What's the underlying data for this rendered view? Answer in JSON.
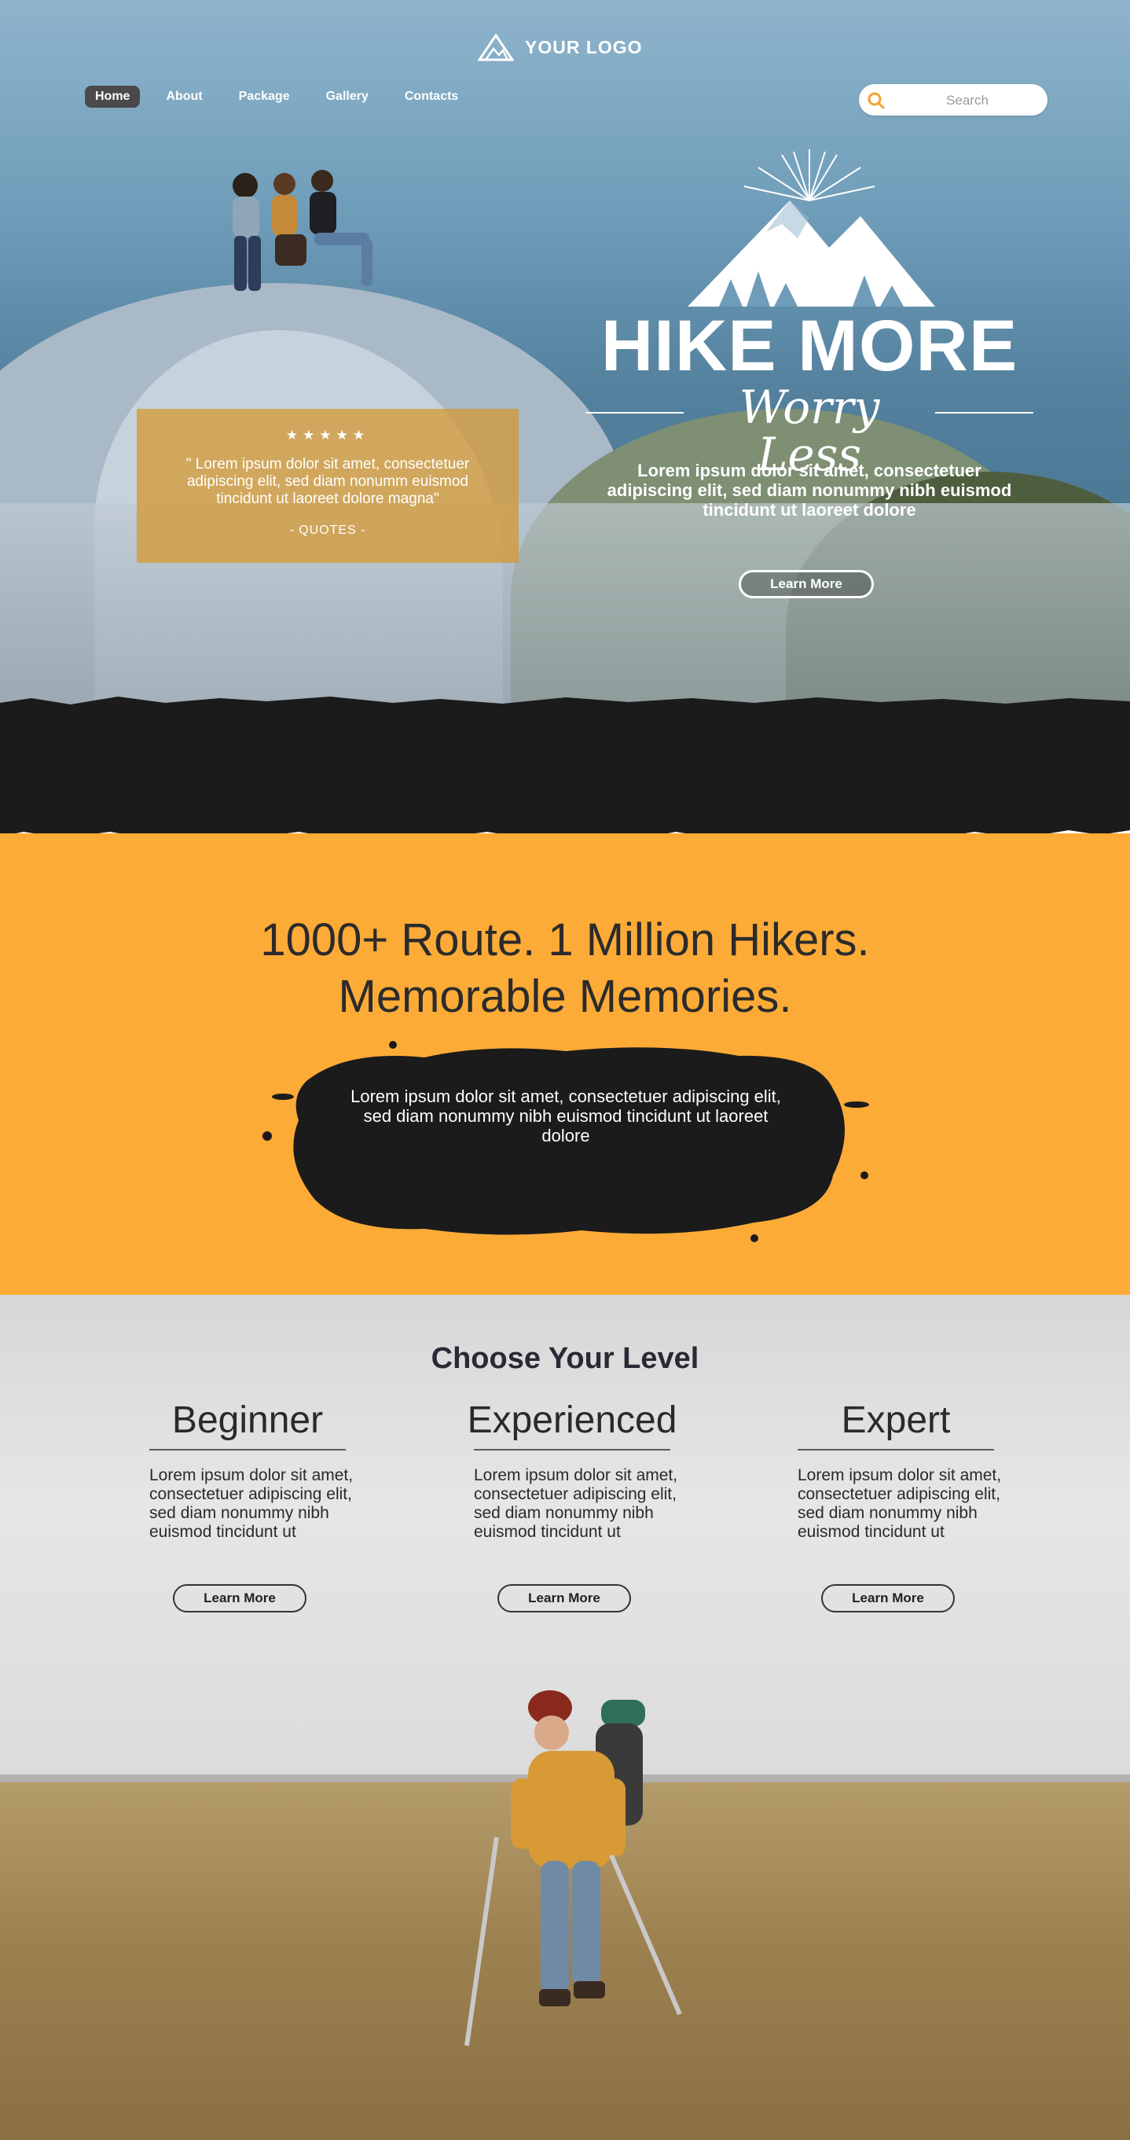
{
  "header": {
    "logo_text": "YOUR LOGO",
    "nav": [
      {
        "label": "Home",
        "active": true
      },
      {
        "label": "About",
        "active": false
      },
      {
        "label": "Package",
        "active": false
      },
      {
        "label": "Gallery",
        "active": false
      },
      {
        "label": "Contacts",
        "active": false
      }
    ],
    "search": {
      "placeholder": "Search",
      "value": ""
    }
  },
  "hero": {
    "quote": {
      "stars": "★★★★★",
      "text": "\" Lorem ipsum dolor sit amet, consectetuer adipiscing elit, sed diam nonumm euismod tincidunt ut laoreet dolore magna\"",
      "author": "- QUOTES -"
    },
    "title": "HIKE MORE",
    "subtitle": "Worry Less",
    "description": "Lorem ipsum dolor sit amet, consectetuer adipiscing elit, sed diam nonummy nibh euismod tincidunt ut laoreet dolore",
    "button_label": "Learn More"
  },
  "stats": {
    "heading_line1": "1000+ Route. 1 Million Hikers.",
    "heading_line2": "Memorable Memories.",
    "description": "Lorem ipsum dolor sit amet, consectetuer adipiscing elit, sed diam nonummy nibh euismod tincidunt ut laoreet dolore"
  },
  "levels": {
    "title": "Choose Your Level",
    "items": [
      {
        "name": "Beginner",
        "description": "Lorem ipsum dolor sit amet, consectetuer adipiscing elit, sed diam nonummy nibh euismod tincidunt ut",
        "button_label": "Learn More"
      },
      {
        "name": "Experienced",
        "description": "Lorem ipsum dolor sit amet, consectetuer adipiscing elit, sed diam nonummy nibh euismod tincidunt ut",
        "button_label": "Learn More"
      },
      {
        "name": "Expert",
        "description": "Lorem ipsum dolor sit amet, consectetuer adipiscing elit, sed diam nonummy nibh euismod tincidunt ut",
        "button_label": "Learn More"
      }
    ]
  },
  "colors": {
    "accent_orange": "#fdab37",
    "dark": "#1b1b1b",
    "white": "#ffffff",
    "nav_active": "#4a4a4a"
  },
  "icons": [
    "logo-mountain-icon",
    "search-icon",
    "mountain-emblem-icon"
  ]
}
